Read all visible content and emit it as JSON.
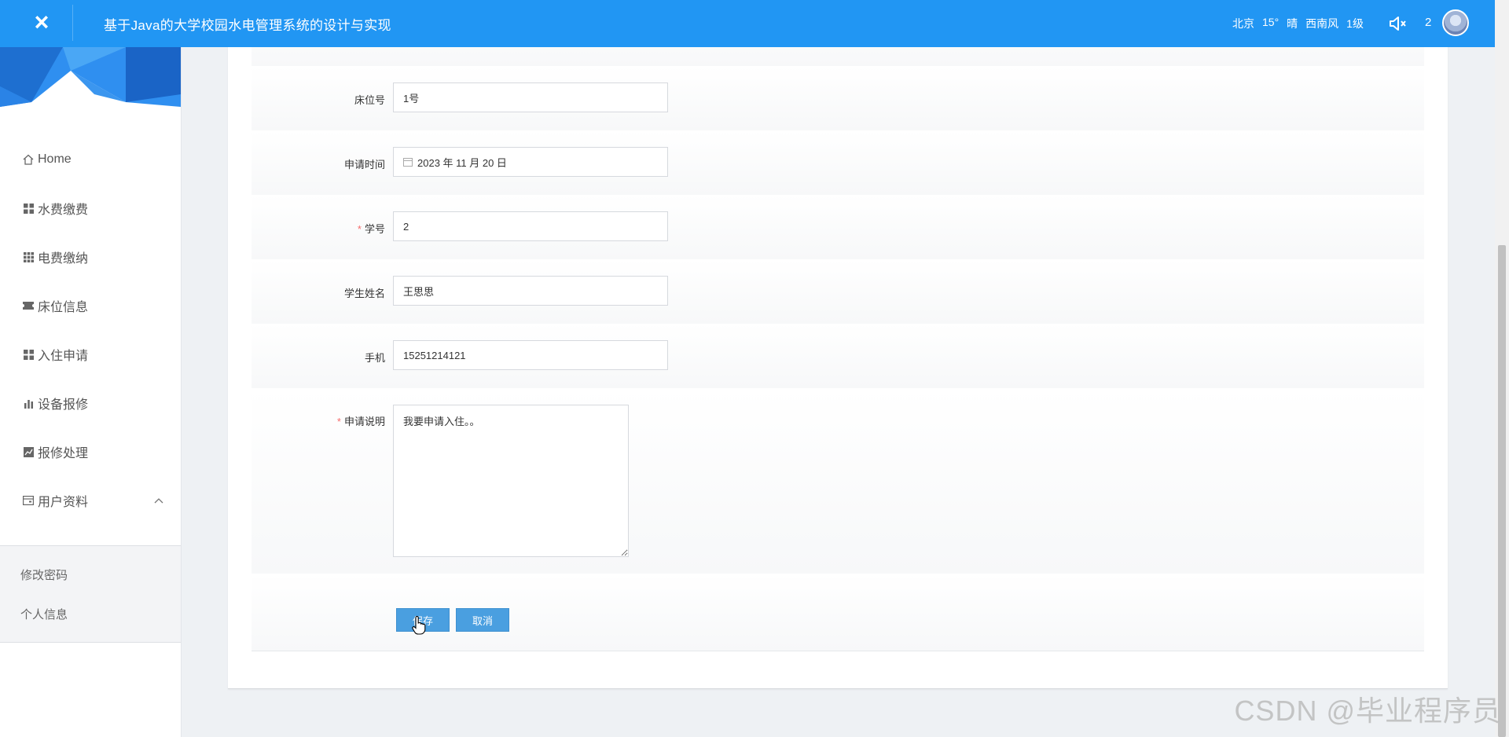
{
  "header": {
    "close_icon": "×",
    "title": "基于Java的大学校园水电管理系统的设计与实现",
    "weather": {
      "city": "北京",
      "temperature": "15°",
      "condition": "晴",
      "wind": "西南风",
      "level": "1级"
    },
    "sound_icon": "speaker-mute-icon",
    "count": "2",
    "avatar_icon": "user-avatar"
  },
  "sidebar": {
    "items": [
      {
        "label": "Home",
        "icon": "home-icon"
      },
      {
        "label": "水费缴费",
        "icon": "grid-icon"
      },
      {
        "label": "电费缴纳",
        "icon": "grid-9-icon"
      },
      {
        "label": "床位信息",
        "icon": "ticket-icon"
      },
      {
        "label": "入住申请",
        "icon": "grid-icon"
      },
      {
        "label": "设备报修",
        "icon": "bar-chart-icon"
      },
      {
        "label": "报修处理",
        "icon": "line-chart-icon"
      },
      {
        "label": "用户资料",
        "icon": "card-icon"
      }
    ],
    "submenu": [
      {
        "label": "修改密码"
      },
      {
        "label": "个人信息"
      }
    ]
  },
  "form": {
    "bed": {
      "label": "床位号",
      "value": "1号"
    },
    "apply_time": {
      "label": "申请时间",
      "value": "2023 年 11 月 20 日"
    },
    "student_no": {
      "label": "学号",
      "value": "2",
      "required": "*"
    },
    "student_name": {
      "label": "学生姓名",
      "value": "王思思"
    },
    "phone": {
      "label": "手机",
      "value": "15251214121"
    },
    "description": {
      "label": "申请说明",
      "value": "我要申请入住。。",
      "required": "*"
    },
    "save_label": "保存",
    "cancel_label": "取消"
  },
  "watermark": "CSDN @毕业程序员",
  "colors": {
    "topbar": "#2196f3",
    "button": "#4a9fe0",
    "required": "#f56c6c"
  }
}
